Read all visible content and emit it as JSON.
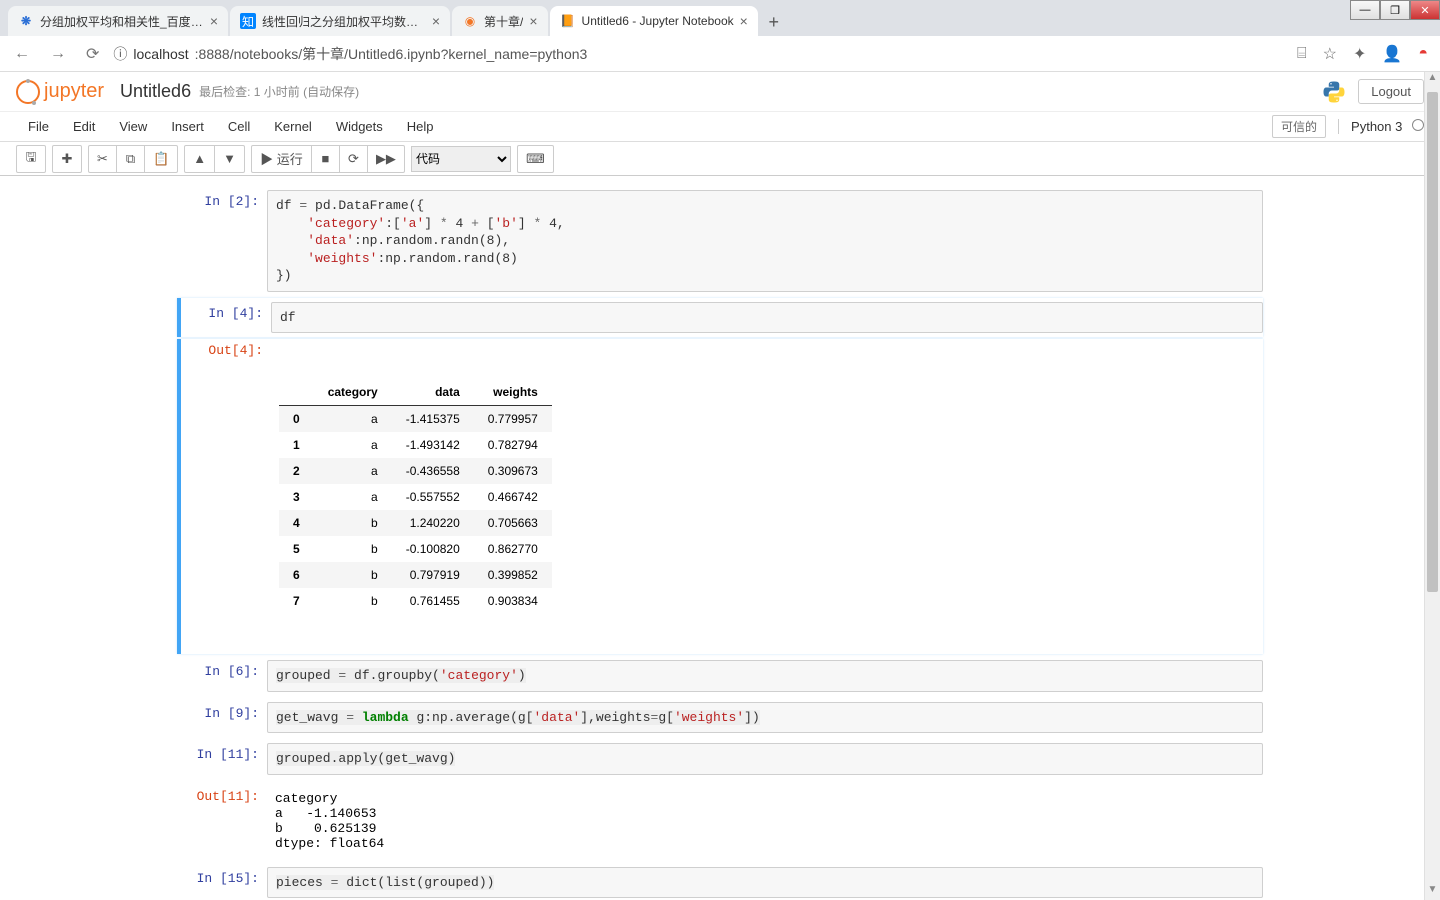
{
  "window": {
    "min": "—",
    "max": "❐",
    "close": "✕"
  },
  "tabs": [
    {
      "title": "分组加权平均和相关性_百度搜索",
      "favicon": "❋",
      "faviconClass": "fav-baidu"
    },
    {
      "title": "线性回归之分组加权平均数和相…",
      "favicon": "知",
      "faviconClass": "fav-zhihu"
    },
    {
      "title": "第十章/",
      "favicon": "◉",
      "faviconClass": "fav-jup"
    },
    {
      "title": "Untitled6 - Jupyter Notebook",
      "favicon": "📙",
      "faviconClass": ""
    }
  ],
  "newtab": "+",
  "url": {
    "info": "ⓘ",
    "host": "localhost",
    "rest": ":8888/notebooks/第十章/Untitled6.ipynb?kernel_name=python3"
  },
  "toolbar_icons": {
    "translate": "⌸",
    "star": "☆",
    "ext": "✦",
    "user": "👤",
    "more": "◓"
  },
  "jupyter": {
    "logo": "jupyter",
    "nb_name": "Untitled6",
    "checkpoint": "最后检查: 1 小时前  (自动保存)",
    "logout": "Logout",
    "menus": [
      "File",
      "Edit",
      "View",
      "Insert",
      "Cell",
      "Kernel",
      "Widgets",
      "Help"
    ],
    "trusted": "可信的",
    "kernel": "Python 3",
    "tb": {
      "save": "🖫",
      "add": "✚",
      "cut": "✂",
      "copy": "⧉",
      "paste": "📋",
      "up": "▲",
      "down": "▼",
      "run": "▶ 运行",
      "stop": "■",
      "restart": "⟳",
      "ff": "▶▶",
      "celltype": "代码",
      "palette": "⌨"
    }
  },
  "cells": {
    "c2": {
      "prompt": "In  [2]:"
    },
    "c4": {
      "prompt": "In  [4]:",
      "code": "df",
      "out_prompt": "Out[4]:"
    },
    "c6": {
      "prompt": "In  [6]:"
    },
    "c9": {
      "prompt": "In  [9]:"
    },
    "c11": {
      "prompt": "In  [11]:",
      "out_prompt": "Out[11]:",
      "output": "category\na   -1.140653\nb    0.625139\ndtype: float64"
    },
    "c15": {
      "prompt": "In  [15]:"
    }
  },
  "df": {
    "columns": [
      "",
      "category",
      "data",
      "weights"
    ],
    "rows": [
      [
        "0",
        "a",
        "-1.415375",
        "0.779957"
      ],
      [
        "1",
        "a",
        "-1.493142",
        "0.782794"
      ],
      [
        "2",
        "a",
        "-0.436558",
        "0.309673"
      ],
      [
        "3",
        "a",
        "-0.557552",
        "0.466742"
      ],
      [
        "4",
        "b",
        "1.240220",
        "0.705663"
      ],
      [
        "5",
        "b",
        "-0.100820",
        "0.862770"
      ],
      [
        "6",
        "b",
        "0.797919",
        "0.399852"
      ],
      [
        "7",
        "b",
        "0.761455",
        "0.903834"
      ]
    ]
  }
}
